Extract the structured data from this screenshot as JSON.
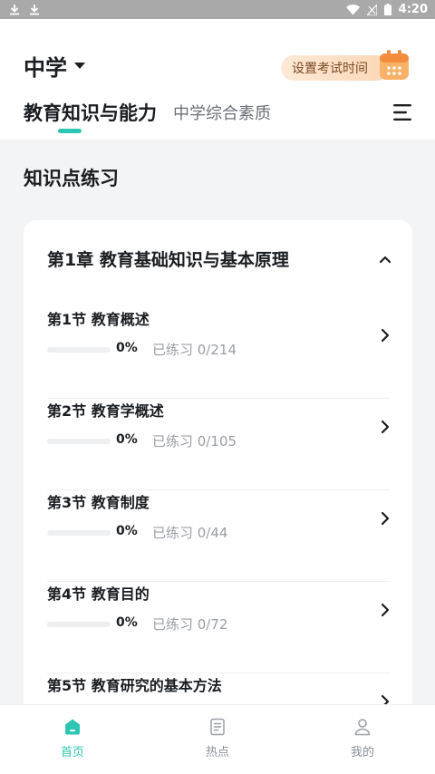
{
  "status_bar": {
    "time": "4:20",
    "left_icons": [
      "download-icon",
      "download-icon"
    ],
    "right_icons": [
      "wifi-icon",
      "signal-icon",
      "battery-icon"
    ]
  },
  "header": {
    "level": "中学",
    "exam_button_label": "设置考试时间",
    "tabs": [
      {
        "label": "教育知识与能力",
        "active": true
      },
      {
        "label": "中学综合素质",
        "active": false
      }
    ]
  },
  "section_title": "知识点练习",
  "chapter": {
    "title": "第1章 教育基础知识与基本原理",
    "expanded": true,
    "sections": [
      {
        "title": "第1节 教育概述",
        "percent": "0%",
        "practiced": "已练习 0/214",
        "progress": 0
      },
      {
        "title": "第2节 教育学概述",
        "percent": "0%",
        "practiced": "已练习 0/105",
        "progress": 0
      },
      {
        "title": "第3节 教育制度",
        "percent": "0%",
        "practiced": "已练习 0/44",
        "progress": 0
      },
      {
        "title": "第4节 教育目的",
        "percent": "0%",
        "practiced": "已练习 0/72",
        "progress": 0
      },
      {
        "title": "第5节 教育研究的基本方法",
        "percent": "",
        "practiced": "",
        "progress": 0
      }
    ]
  },
  "bottom_nav": [
    {
      "label": "首页",
      "icon": "home-icon",
      "active": true
    },
    {
      "label": "热点",
      "icon": "document-icon",
      "active": false
    },
    {
      "label": "我的",
      "icon": "person-icon",
      "active": false
    }
  ],
  "colors": {
    "accent": "#2dc6b4",
    "exam_pill": "#fbd7b7",
    "background": "#f3f4f6"
  }
}
